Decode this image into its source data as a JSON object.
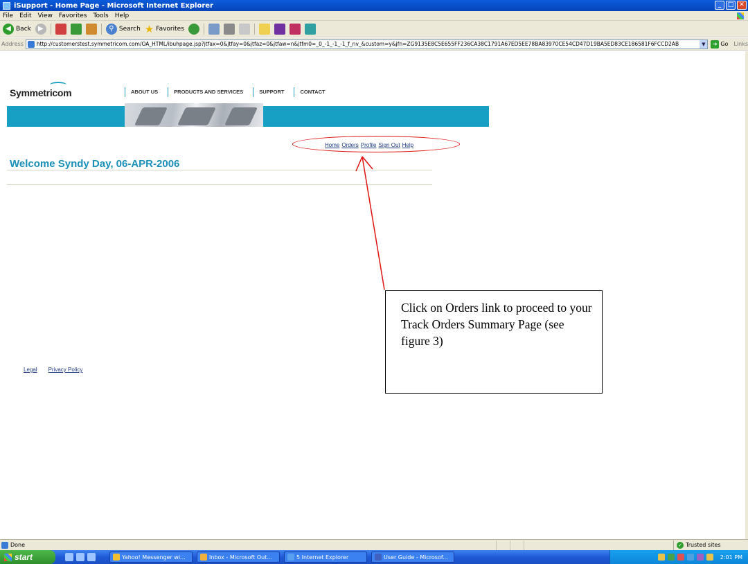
{
  "window": {
    "title": "iSupport - Home Page - Microsoft Internet Explorer"
  },
  "menu": [
    "File",
    "Edit",
    "View",
    "Favorites",
    "Tools",
    "Help"
  ],
  "toolbar": {
    "back_label": "Back",
    "search_label": "Search",
    "favorites_label": "Favorites"
  },
  "address": {
    "label": "Address",
    "url": "http://customerstest.symmetricom.com/OA_HTML/ibuhpage.jsp?jtfax=0&jtfay=0&jtfaz=0&jtfaw=n&jtfm0=_0_-1_-1_-1_f_nv_&custom=y&jfn=ZG9135E8C5E655FF236CA38C1791A67ED5EE78BA83970CE54CD47D19BA5ED83CE186581F6FCCD2AB",
    "go_label": "Go",
    "links_label": "Links"
  },
  "site": {
    "logo_text": "Symmetricom",
    "nav": [
      "ABOUT US",
      "PRODUCTS AND SERVICES",
      "SUPPORT",
      "CONTACT"
    ],
    "quick_links": [
      "Home",
      "Orders",
      "Profile",
      "Sign Out",
      "Help"
    ],
    "welcome": "Welcome Syndy Day, 06-APR-2006",
    "footer_links": [
      "Legal",
      "Privacy Policy"
    ]
  },
  "callout": {
    "text": "Click on Orders link to proceed to your Track Orders Summary Page (see figure 3)"
  },
  "status": {
    "left": "Done",
    "zone": "Trusted sites"
  },
  "taskbar": {
    "start_label": "start",
    "tasks": [
      "Yahoo! Messenger wi...",
      "Inbox - Microsoft Out...",
      "5 Internet Explorer",
      "User Guide - Microsof..."
    ],
    "clock": "2:01 PM"
  },
  "colors": {
    "brand_teal": "#18a0c4",
    "welcome_text": "#1a8fb8",
    "annotation_red": "#e01010"
  }
}
